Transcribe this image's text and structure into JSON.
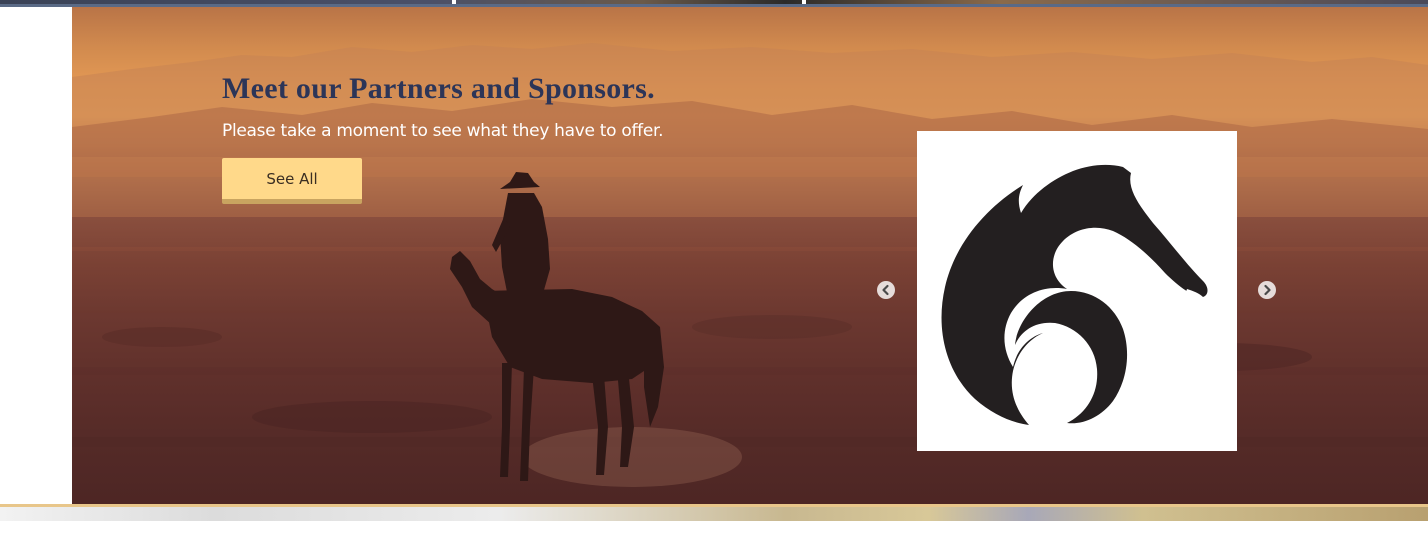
{
  "hero": {
    "title": "Meet our Partners and Sponsors.",
    "subtitle": "Please take a moment to see what they have to offer.",
    "button_label": "See All",
    "colors": {
      "title": "#2c3558",
      "button_bg": "#ffd98a",
      "button_border": "#c9a460",
      "sky": "#e49a55",
      "ground": "#5f302b"
    }
  },
  "carousel": {
    "prev_icon": "chevron-left-icon",
    "next_icon": "chevron-right-icon",
    "current_slide_logo": "horse-head-logo"
  }
}
